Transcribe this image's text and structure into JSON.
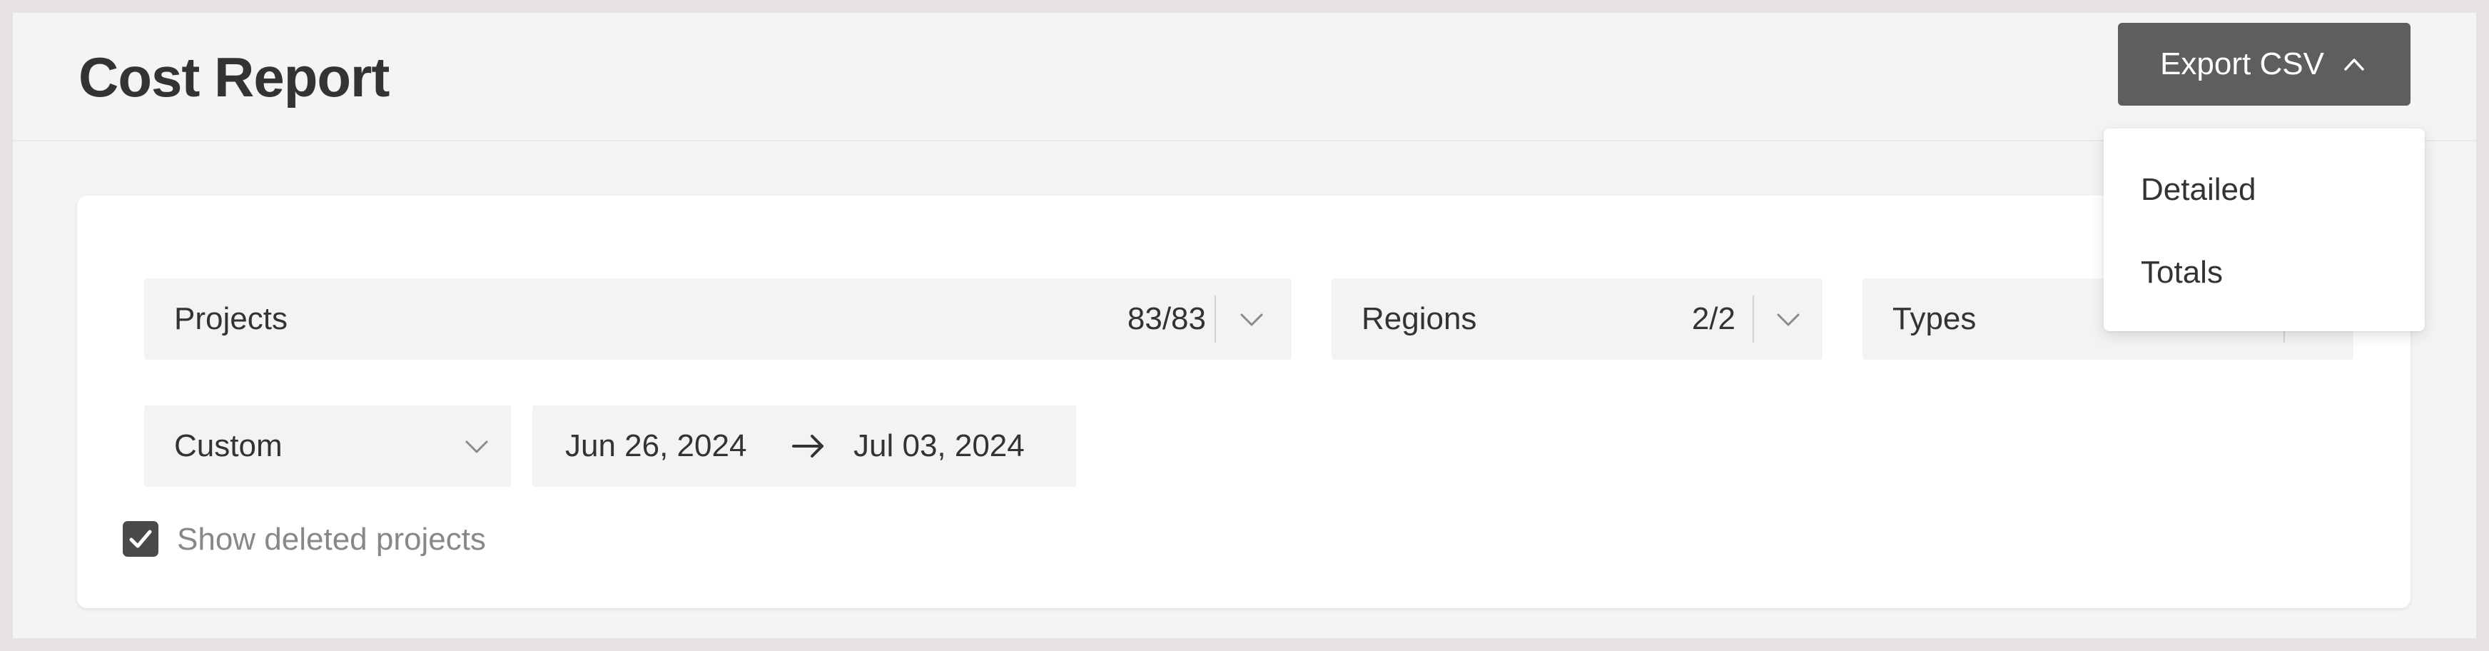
{
  "header": {
    "title": "Cost Report",
    "export_label": "Export CSV"
  },
  "export_menu": {
    "items": [
      {
        "label": "Detailed"
      },
      {
        "label": "Totals"
      }
    ]
  },
  "filters": {
    "projects": {
      "label": "Projects",
      "count": "83/83"
    },
    "regions": {
      "label": "Regions",
      "count": "2/2"
    },
    "types": {
      "label": "Types"
    },
    "period": {
      "label": "Custom"
    },
    "date_range": {
      "start": "Jun 26, 2024",
      "end": "Jul 03, 2024"
    },
    "show_deleted": {
      "label": "Show deleted projects",
      "checked": true
    }
  },
  "icons": {
    "export_chevron": "chevron-up-icon",
    "select_chevron": "chevron-down-icon",
    "range_arrow": "arrow-right-icon",
    "checkbox": "checkmark-icon"
  },
  "colors": {
    "primary_button": "#5e5e5e",
    "page_background": "#f4f4f4",
    "select_background": "#f3f3f3",
    "checkbox": "#4a4a4a"
  }
}
